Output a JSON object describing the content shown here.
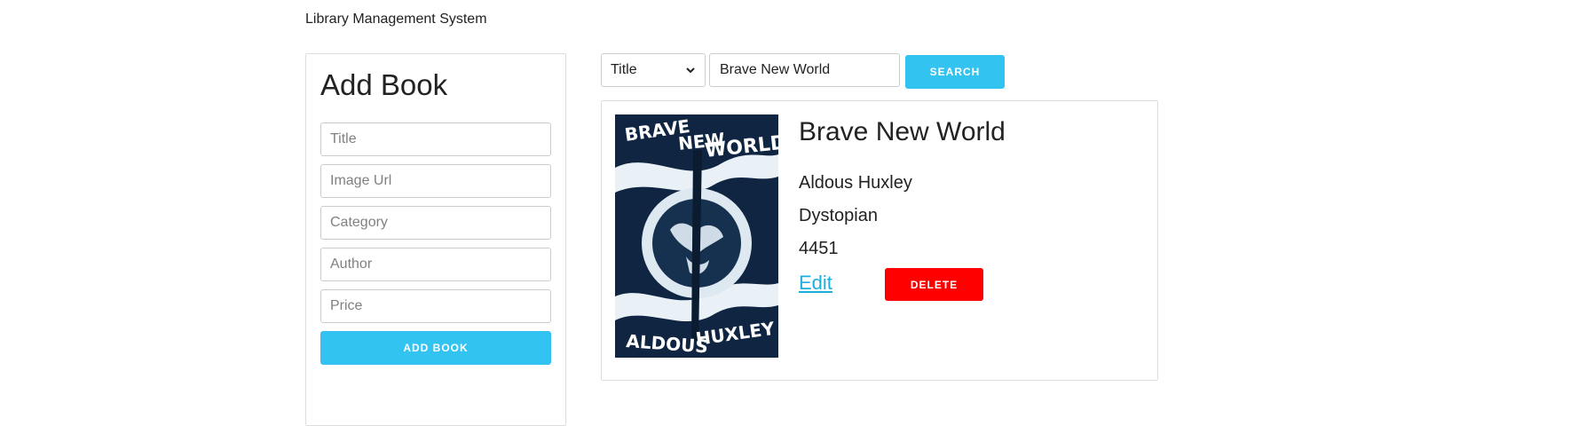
{
  "app": {
    "title": "Library Management System"
  },
  "add_form": {
    "heading": "Add Book",
    "title_placeholder": "Title",
    "image_placeholder": "Image Url",
    "category_placeholder": "Category",
    "author_placeholder": "Author",
    "price_placeholder": "Price",
    "submit_label": "ADD BOOK"
  },
  "search": {
    "field_selected": "Title",
    "query": "Brave New World",
    "button_label": "SEARCH"
  },
  "result": {
    "title": "Brave New World",
    "author": "Aldous Huxley",
    "category": "Dystopian",
    "price": "4451",
    "edit_label": "Edit",
    "delete_label": "DELETE",
    "cover": {
      "title_line1": "BRAVE",
      "title_line2": "NEW",
      "title_line3": "WORLD",
      "author_line1": "ALDOUS",
      "author_line2": "HUXLEY"
    }
  },
  "colors": {
    "accent": "#33c3f0",
    "danger": "#ff0000",
    "link": "#1eaedb"
  },
  "icons": {
    "select_arrow": "chevron-down-icon"
  }
}
